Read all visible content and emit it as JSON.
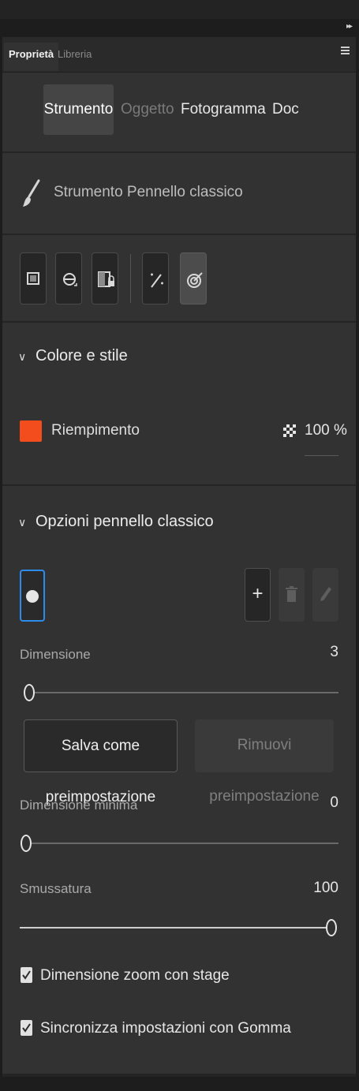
{
  "panel": {
    "tabs": {
      "active": "Proprietà",
      "inactive": "Libreria"
    }
  },
  "segments": [
    {
      "label": "Strumento",
      "state": "active"
    },
    {
      "label": "Oggetto",
      "state": "disabled"
    },
    {
      "label": "Fotogramma",
      "state": "normal"
    },
    {
      "label": "Doc",
      "state": "normal"
    }
  ],
  "tool": {
    "name": "Strumento Pennello classico",
    "icon": "brush-icon"
  },
  "toolbar_icons": [
    "object-drawing-icon",
    "smoothing-mode-icon",
    "lock-fill-icon",
    "magic-pressure-icon",
    "tilt-target-icon"
  ],
  "color_style": {
    "title": "Colore e stile",
    "fill_label": "Riempimento",
    "fill_color": "#f34d1e",
    "alpha": "100 %"
  },
  "brush_options": {
    "title": "Opzioni pennello classico",
    "add_glyph": "+",
    "dimension": {
      "label": "Dimensione",
      "value": "3",
      "fraction": 0.0
    },
    "save_preset": "Salva come preimpostazione",
    "remove_preset": "Rimuovi preimpostazione",
    "min_dimension": {
      "label": "Dimensione minima",
      "value": "0",
      "fraction": 0.0
    },
    "smoothing": {
      "label": "Smussatura",
      "value": "100",
      "fraction": 1.0
    },
    "zoom_checkbox": {
      "label": "Dimensione zoom con stage",
      "checked": true
    },
    "sync_checkbox": {
      "label": "Sincronizza impostazioni con Gomma",
      "checked": true
    }
  }
}
